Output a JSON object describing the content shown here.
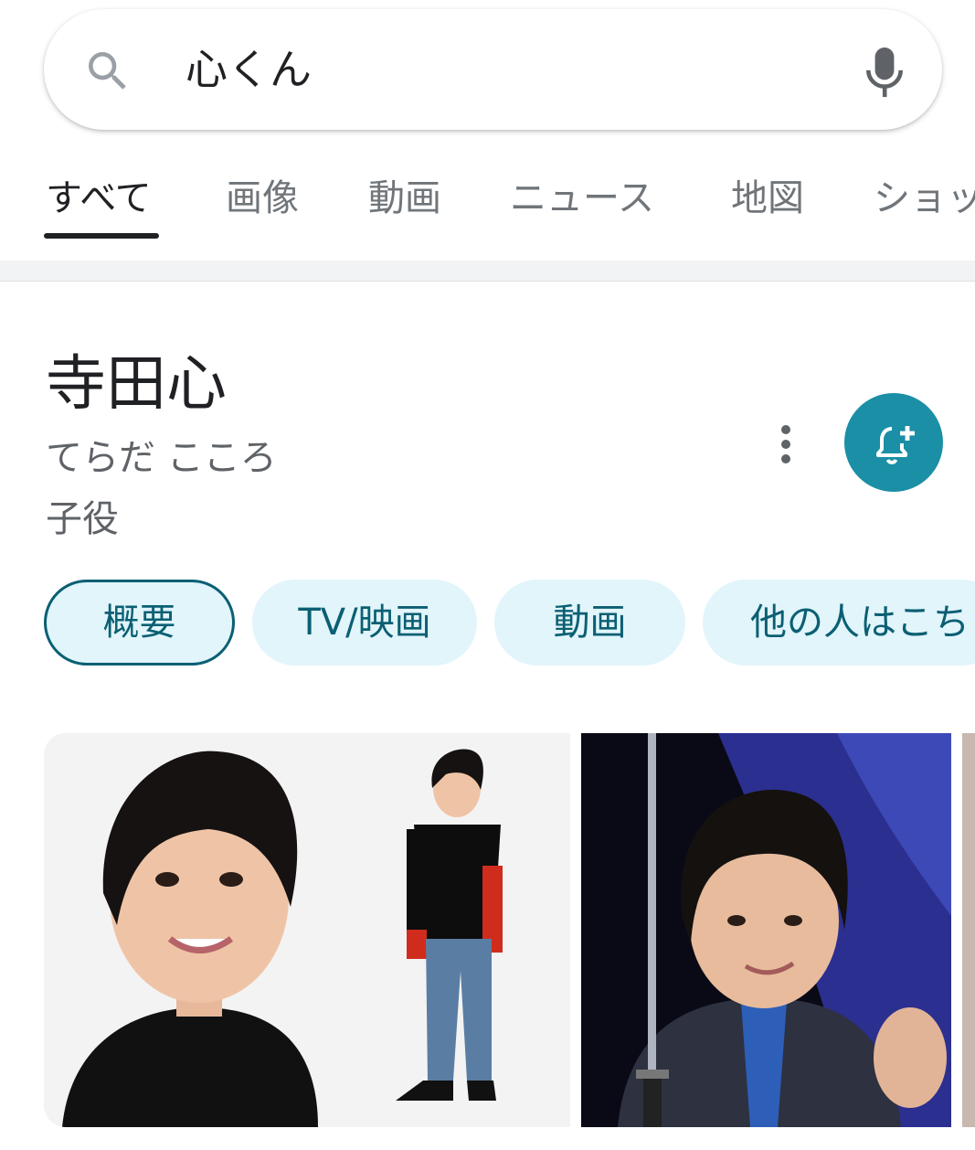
{
  "search": {
    "query": "心くん"
  },
  "tabs": [
    {
      "label": "すべて"
    },
    {
      "label": "画像"
    },
    {
      "label": "動画"
    },
    {
      "label": "ニュース"
    },
    {
      "label": "地図"
    },
    {
      "label": "ショッ"
    }
  ],
  "entity": {
    "title": "寺田心",
    "reading": "てらだ こころ",
    "type": "子役"
  },
  "chips": [
    {
      "label": "概要"
    },
    {
      "label": "TV/映画"
    },
    {
      "label": "動画"
    },
    {
      "label": "他の人はこち"
    }
  ],
  "colors": {
    "accent": "#1a8fa6",
    "chip_bg": "#e1f5fb",
    "chip_text": "#0b5f73"
  },
  "icons": {
    "search": "search-icon",
    "mic": "mic-icon",
    "more": "more-vert-icon",
    "follow": "bell-plus-icon"
  }
}
